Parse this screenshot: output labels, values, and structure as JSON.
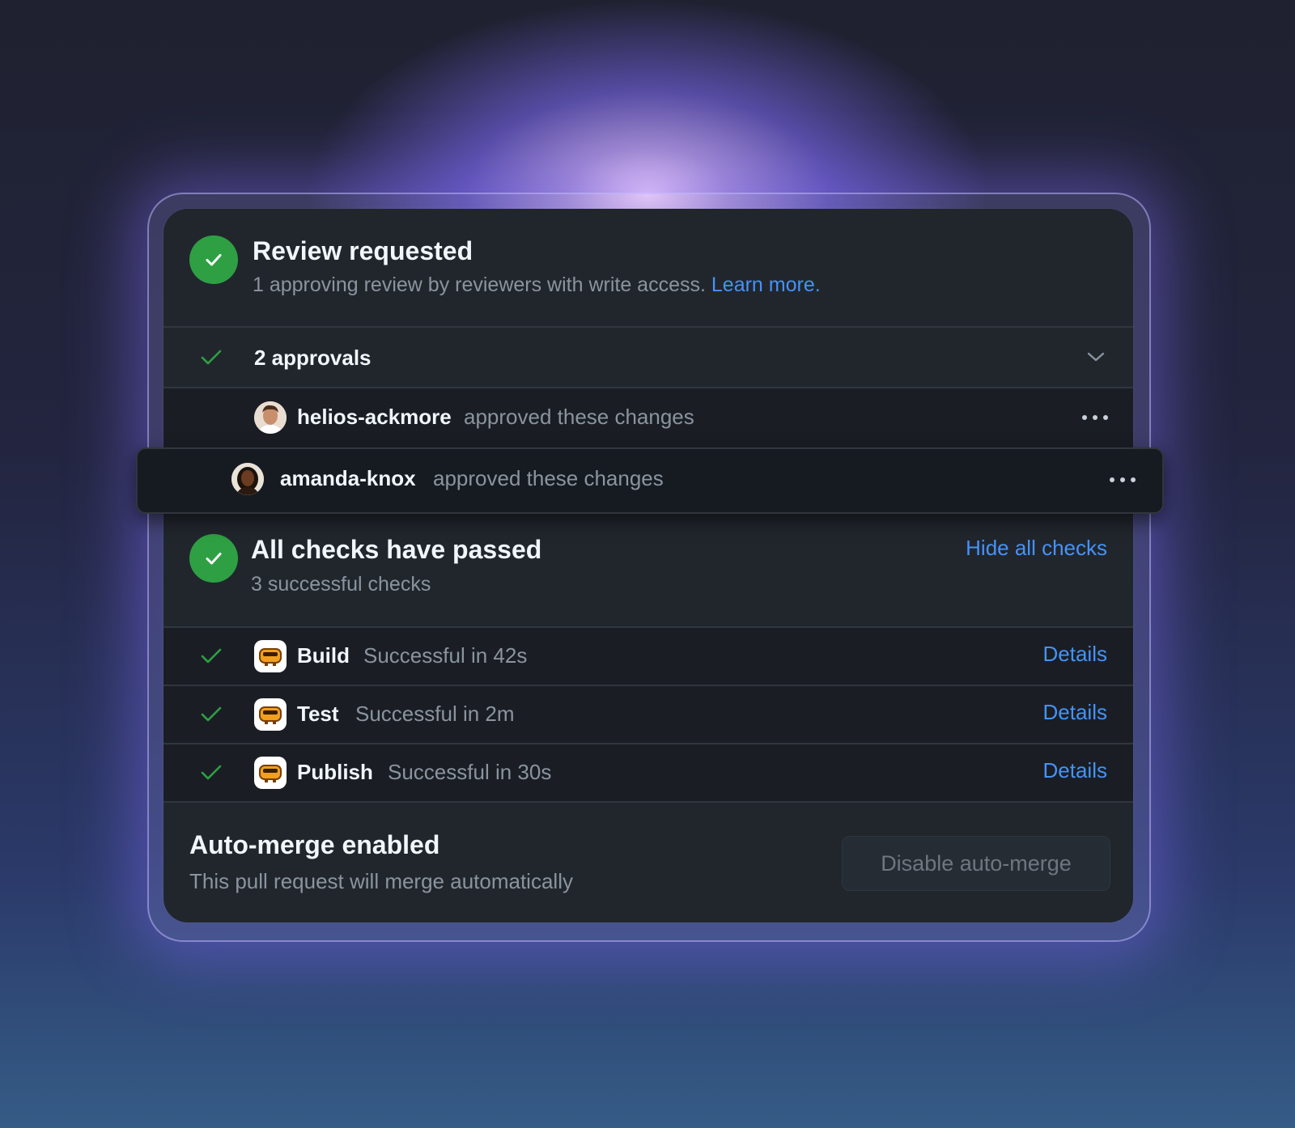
{
  "review": {
    "title": "Review requested",
    "subtitle": "1 approving review by reviewers with write access.",
    "learn_more": "Learn more."
  },
  "approvals": {
    "label": "2 approvals",
    "expand_icon": "chevron-down-icon",
    "items": [
      {
        "user": "helios-ackmore",
        "action": "approved these changes"
      },
      {
        "user": "amanda-knox",
        "action": "approved these changes"
      }
    ]
  },
  "checks": {
    "title": "All checks have passed",
    "subtitle": "3 successful checks",
    "hide_label": "Hide all checks",
    "items": [
      {
        "name": "Build",
        "status": "Successful in 42s",
        "details": "Details"
      },
      {
        "name": "Test",
        "status": "Successful in 2m",
        "details": "Details"
      },
      {
        "name": "Publish",
        "status": "Successful in 30s",
        "details": "Details"
      }
    ]
  },
  "automerge": {
    "title": "Auto-merge enabled",
    "subtitle": "This pull request will merge automatically",
    "button": "Disable auto-merge"
  },
  "colors": {
    "success": "#2ea043",
    "link": "#4493f8",
    "card_bg": "#21262d",
    "row_bg": "#1a1e24"
  }
}
